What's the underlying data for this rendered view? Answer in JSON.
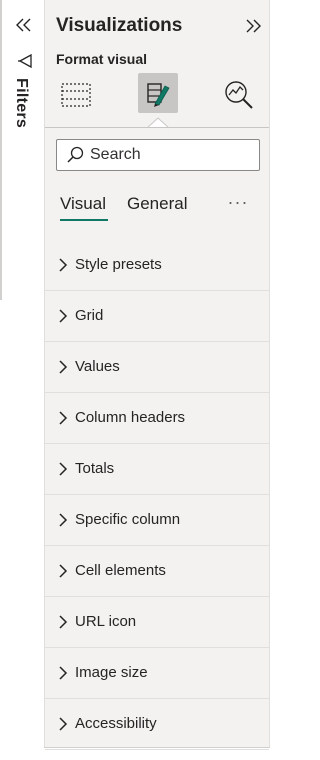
{
  "filters": {
    "label": "Filters",
    "collapse_icon": "double-chevron-left-icon",
    "icon": "filter-funnel-icon"
  },
  "visualizations": {
    "title": "Visualizations",
    "expand_icon": "double-chevron-right-icon",
    "subtitle": "Format visual",
    "icons": [
      "build-visual-icon",
      "format-visual-icon",
      "analytics-icon"
    ],
    "search": {
      "placeholder": "Search",
      "value": ""
    },
    "tabs": [
      {
        "label": "Visual",
        "active": true
      },
      {
        "label": "General",
        "active": false
      }
    ],
    "more_label": "···",
    "sections": [
      {
        "label": "Style presets"
      },
      {
        "label": "Grid"
      },
      {
        "label": "Values"
      },
      {
        "label": "Column headers"
      },
      {
        "label": "Totals"
      },
      {
        "label": "Specific column"
      },
      {
        "label": "Cell elements"
      },
      {
        "label": "URL icon"
      },
      {
        "label": "Image size"
      },
      {
        "label": "Accessibility"
      }
    ]
  },
  "colors": {
    "accent": "#117865",
    "pane_bg": "#f3f2f1",
    "selected_icon_bg": "#c8c6c4"
  }
}
